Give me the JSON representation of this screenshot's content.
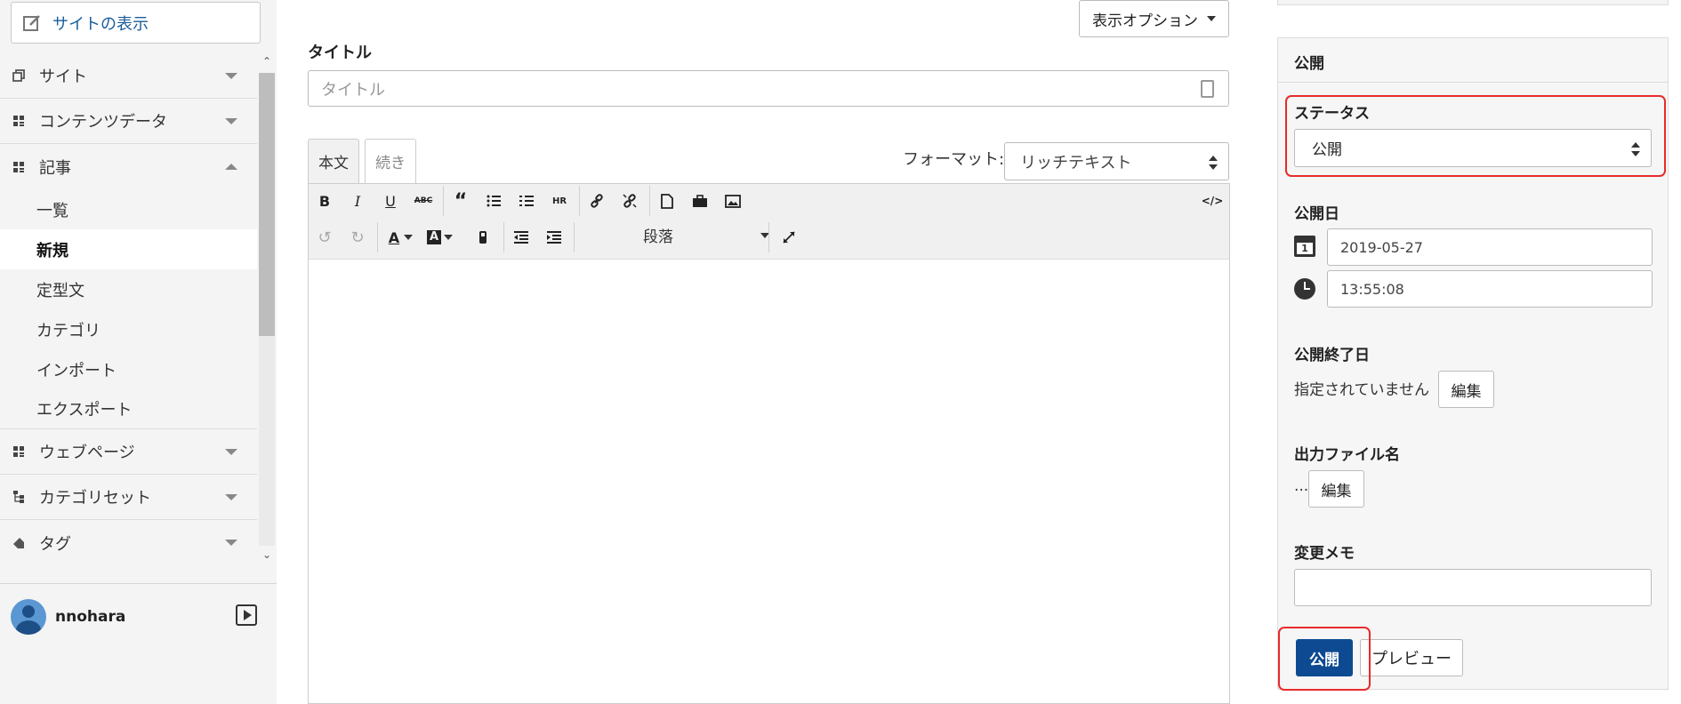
{
  "sidebar": {
    "view_site": "サイトの表示",
    "items": [
      {
        "label": "サイト"
      },
      {
        "label": "コンテンツデータ"
      },
      {
        "label": "記事"
      },
      {
        "label": "ウェブページ"
      },
      {
        "label": "カテゴリセット"
      },
      {
        "label": "タグ"
      }
    ],
    "sub_items": [
      "一覧",
      "新規",
      "定型文",
      "カテゴリ",
      "インポート",
      "エクスポート"
    ],
    "active_sub": "新規"
  },
  "user": {
    "name": "nnohara"
  },
  "main": {
    "display_options": "表示オプション",
    "title_label": "タイトル",
    "title_placeholder": "タイトル",
    "tabs": [
      "本文",
      "続き"
    ],
    "format_label": "フォーマット:",
    "format_value": "リッチテキスト",
    "paragraph_value": "段落",
    "toolbar_labels": {
      "strike": "ABC",
      "hr": "HR",
      "source": "</>"
    }
  },
  "publish_panel": {
    "heading": "公開",
    "status_label": "ステータス",
    "status_value": "公開",
    "publish_date_label": "公開日",
    "date": "2019-05-27",
    "time": "13:55:08",
    "end_date_label": "公開終了日",
    "end_date_text": "指定されていません",
    "edit_label": "編集",
    "filename_label": "出力ファイル名",
    "filename_value": "...",
    "memo_label": "変更メモ",
    "publish_button": "公開",
    "preview_button": "プレビュー"
  },
  "colors": {
    "primary": "#0d4a92",
    "highlight": "#e82b2b",
    "link": "#1a5d9b"
  }
}
